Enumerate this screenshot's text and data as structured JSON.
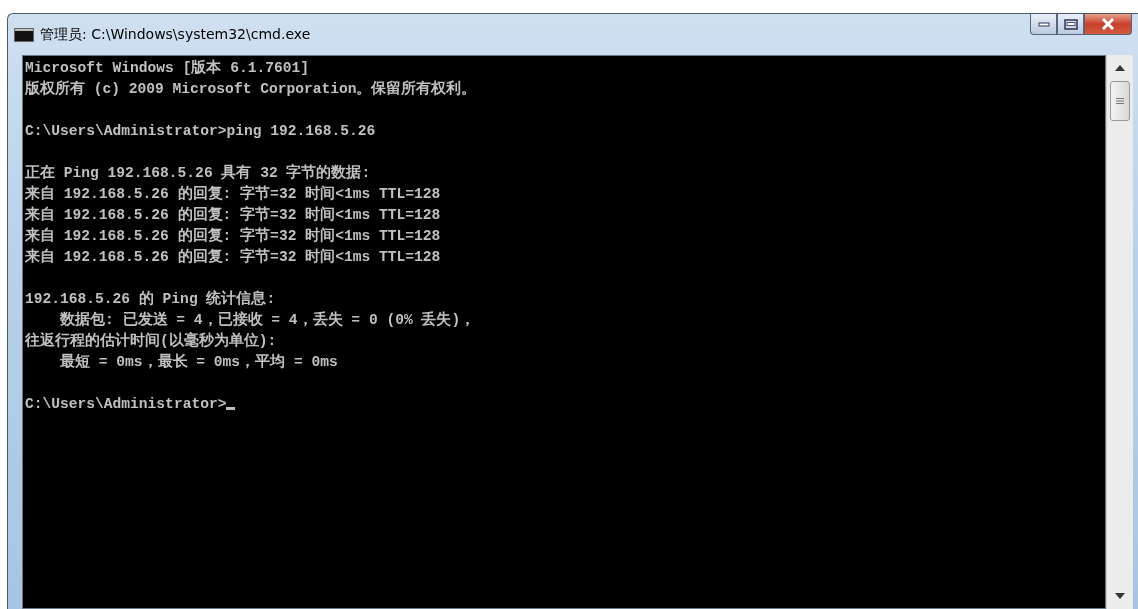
{
  "window": {
    "title": "管理员: C:\\Windows\\system32\\cmd.exe"
  },
  "console": {
    "lines": [
      {
        "kind": "text",
        "text": "Microsoft Windows [版本 6.1.7601]"
      },
      {
        "kind": "text",
        "text": "版权所有 (c) 2009 Microsoft Corporation。保留所有权利。"
      },
      {
        "kind": "blank"
      },
      {
        "kind": "text",
        "text": "C:\\Users\\Administrator>ping 192.168.5.26"
      },
      {
        "kind": "blank"
      },
      {
        "kind": "text",
        "text": "正在 Ping 192.168.5.26 具有 32 字节的数据:"
      },
      {
        "kind": "text",
        "text": "来自 192.168.5.26 的回复: 字节=32 时间<1ms TTL=128"
      },
      {
        "kind": "text",
        "text": "来自 192.168.5.26 的回复: 字节=32 时间<1ms TTL=128"
      },
      {
        "kind": "text",
        "text": "来自 192.168.5.26 的回复: 字节=32 时间<1ms TTL=128"
      },
      {
        "kind": "text",
        "text": "来自 192.168.5.26 的回复: 字节=32 时间<1ms TTL=128"
      },
      {
        "kind": "blank"
      },
      {
        "kind": "text",
        "text": "192.168.5.26 的 Ping 统计信息:"
      },
      {
        "kind": "text",
        "text": "    数据包: 已发送 = 4，已接收 = 4，丢失 = 0 (0% 丢失)，"
      },
      {
        "kind": "text",
        "text": "往返行程的估计时间(以毫秒为单位):"
      },
      {
        "kind": "text",
        "text": "    最短 = 0ms，最长 = 0ms，平均 = 0ms"
      },
      {
        "kind": "blank"
      },
      {
        "kind": "text",
        "text": "C:\\Users\\Administrator>",
        "cursor": true
      }
    ]
  }
}
